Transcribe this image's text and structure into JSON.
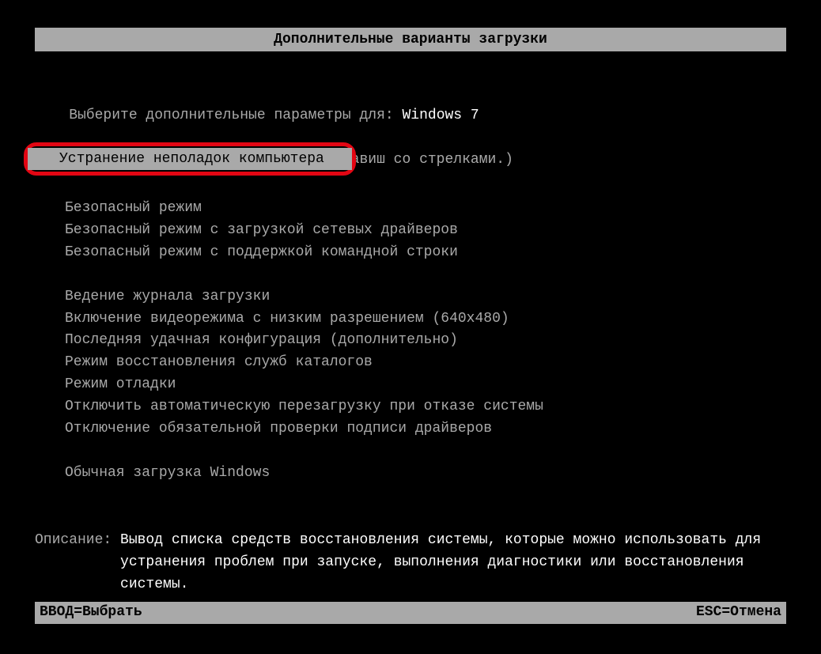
{
  "header": {
    "title": "Дополнительные варианты загрузки"
  },
  "prompt": {
    "line1_prefix": "Выберите дополнительные параметры для: ",
    "os_name": "Windows 7",
    "line2": "(Выберите нужный элемент с помощью клавиш со стрелками.)"
  },
  "selected": {
    "label": "Устранение неполадок компьютера"
  },
  "menu": {
    "group1": [
      "Безопасный режим",
      "Безопасный режим с загрузкой сетевых драйверов",
      "Безопасный режим с поддержкой командной строки"
    ],
    "group2": [
      "Ведение журнала загрузки",
      "Включение видеорежима с низким разрешением (640x480)",
      "Последняя удачная конфигурация (дополнительно)",
      "Режим восстановления служб каталогов",
      "Режим отладки",
      "Отключить автоматическую перезагрузку при отказе системы",
      "Отключение обязательной проверки подписи драйверов"
    ],
    "group3": [
      "Обычная загрузка Windows"
    ]
  },
  "description": {
    "label": "Описание: ",
    "text": "Вывод списка средств восстановления системы, которые можно использовать для устранения проблем при запуске, выполнения диагностики или восстановления системы."
  },
  "footer": {
    "enter": "ВВОД=Выбрать",
    "esc": "ESC=Отмена"
  }
}
